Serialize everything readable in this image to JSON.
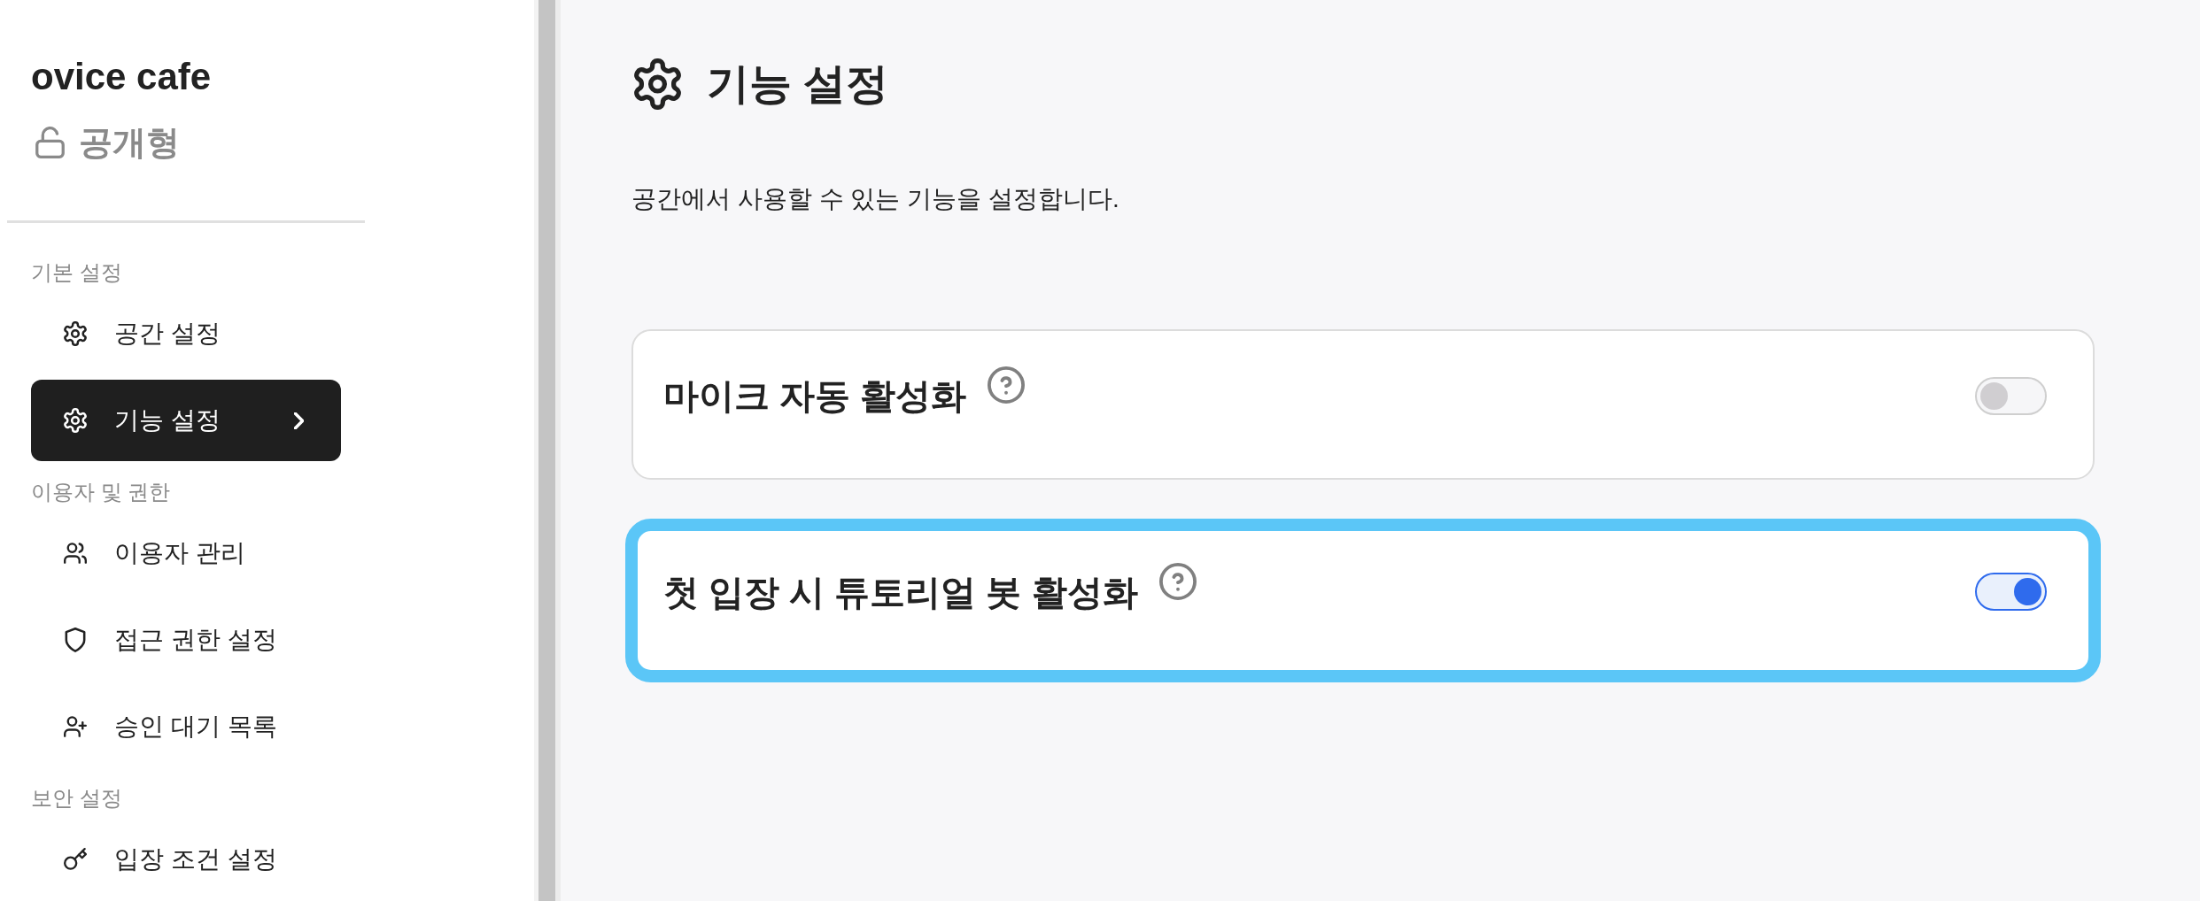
{
  "sidebar": {
    "space_name": "ovice cafe",
    "visibility": "공개형",
    "groups": [
      {
        "label": "기본 설정",
        "items": [
          {
            "label": "공간 설정",
            "kind": "gear",
            "selected": false
          },
          {
            "label": "기능 설정",
            "kind": "gear",
            "selected": true
          }
        ]
      },
      {
        "label": "이용자 및 권한",
        "items": [
          {
            "label": "이용자 관리",
            "kind": "users",
            "selected": false
          },
          {
            "label": "접근 권한 설정",
            "kind": "shield",
            "selected": false
          },
          {
            "label": "승인 대기 목록",
            "kind": "user-plus",
            "selected": false
          }
        ]
      },
      {
        "label": "보안 설정",
        "items": [
          {
            "label": "입장 조건 설정",
            "kind": "key",
            "selected": false
          }
        ]
      }
    ]
  },
  "main": {
    "title": "기능 설정",
    "description": "공간에서 사용할 수 있는 기능을 설정합니다.",
    "features": [
      {
        "label": "마이크 자동 활성화",
        "on": false,
        "highlighted": false
      },
      {
        "label": "첫 입장 시 튜토리얼 봇 활성화",
        "on": true,
        "highlighted": true
      }
    ]
  }
}
